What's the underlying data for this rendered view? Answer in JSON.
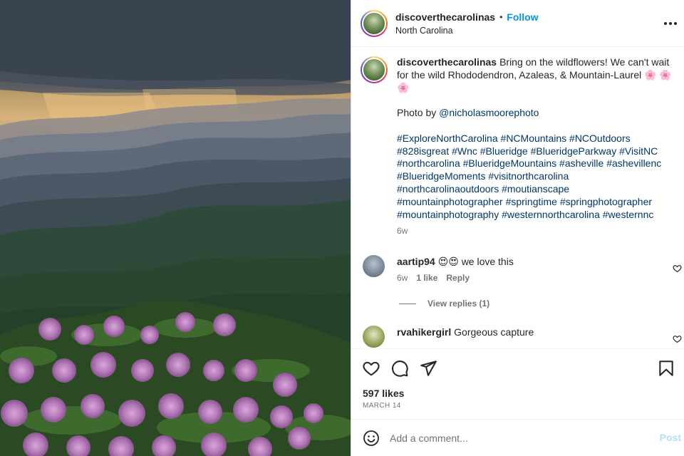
{
  "post": {
    "image_icon": "landscape-photo",
    "author": "discoverthecarolinas",
    "follow_label": "Follow",
    "separator": "•",
    "location": "North Carolina",
    "more_icon": "more-horizontal-icon"
  },
  "caption": {
    "username": "discoverthecarolinas",
    "text_line1": "Bring on the wildflowers! We can't wait for the wild Rhododendron, Azaleas, & Mountain-Laurel",
    "emoji_flowers": "🌸 🌸",
    "emoji_flower_wrap": "🌸",
    "photo_by_prefix": "Photo by ",
    "photo_by_handle": "@nicholasmoorephoto",
    "hashtags": [
      "#ExploreNorthCarolina",
      "#NCMountains",
      "#NCOutdoors",
      "#828isgreat",
      "#Wnc",
      "#Blueridge",
      "#BlueridgeParkway",
      "#VisitNC",
      "#northcarolina",
      "#BlueridgeMountains",
      "#asheville",
      "#ashevillenc",
      "#BlueridgeMoments",
      "#visitnorthcarolina",
      "#northcarolinaoutdoors",
      "#moutianscape",
      "#mountainphotographer",
      "#springtime",
      "#springphotographer",
      "#mountainphotography",
      "#westernnorthcarolina",
      "#westernnc"
    ],
    "time": "6w"
  },
  "comments": [
    {
      "username": "aartip94",
      "emoji": "😍😍",
      "text": "we love this",
      "time": "6w",
      "likes": "1 like",
      "reply_label": "Reply",
      "avatar_color": "#7a8a99"
    },
    {
      "username": "rvahikergirl",
      "text": "Gorgeous capture",
      "avatar_color": "#9aa55a"
    }
  ],
  "view_replies": "View replies (1)",
  "actions": {
    "like_icon": "heart-icon",
    "comment_icon": "comment-icon",
    "share_icon": "send-icon",
    "save_icon": "bookmark-icon",
    "likes": "597 likes",
    "date": "MARCH 14"
  },
  "add_comment": {
    "emoji_icon": "smiley-icon",
    "placeholder": "Add a comment...",
    "post_label": "Post",
    "post_color": "#b2dffc"
  }
}
